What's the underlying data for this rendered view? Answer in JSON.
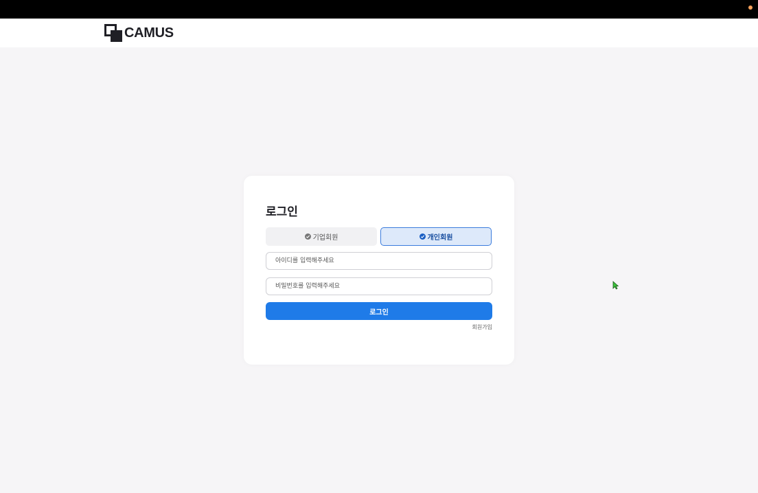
{
  "header": {
    "logo_text": "CAMUS"
  },
  "login": {
    "title": "로그인",
    "tabs": [
      {
        "label": "기업회원",
        "selected": false
      },
      {
        "label": "개인회원",
        "selected": true
      }
    ],
    "id_placeholder": "아이디를 입력해주세요",
    "password_placeholder": "비밀번호를 입력해주세요",
    "submit_label": "로그인",
    "signup_label": "회원가입"
  },
  "colors": {
    "primary": "#1f7be8",
    "tab_selected_bg": "#dde9fa",
    "tab_selected_border": "#3a7bdc",
    "page_bg": "#f6f5f7"
  }
}
